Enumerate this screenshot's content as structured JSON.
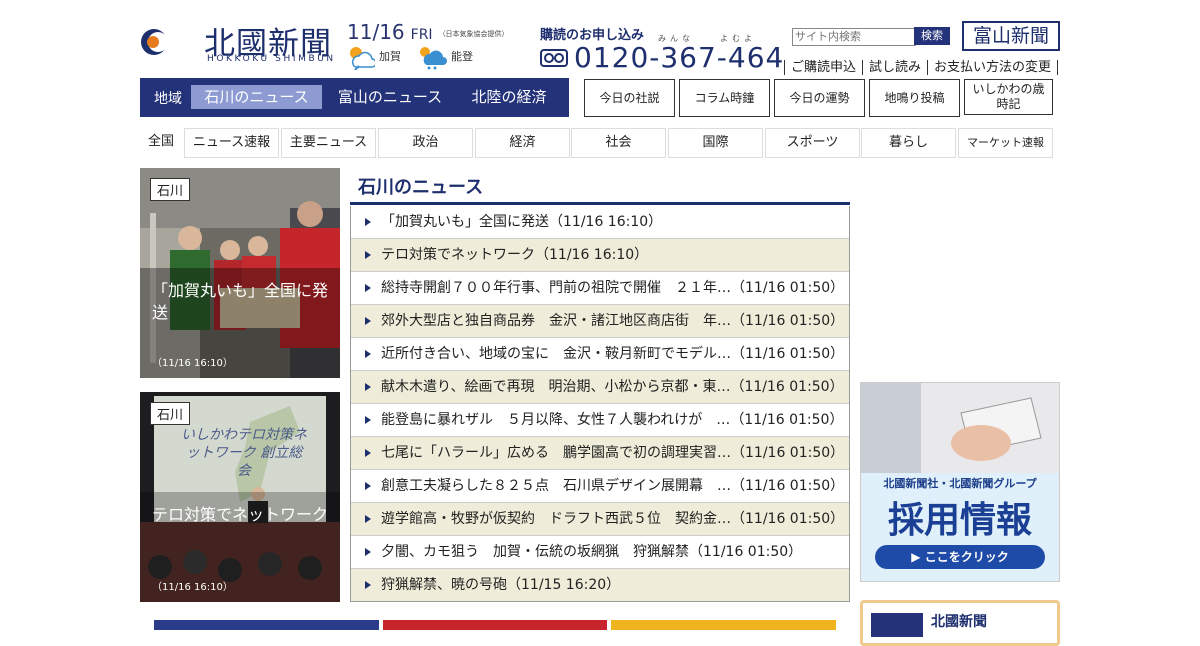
{
  "brand": {
    "name_kanji": "北國新聞",
    "name_roman": "HOKKOKU SHIMBUN"
  },
  "date": {
    "date": "11/16",
    "weekday": "FRI",
    "source_note": "（日本気象協会提供）"
  },
  "weather": [
    {
      "area": "加賀",
      "icon": "sun-cloud-icon"
    },
    {
      "area": "能登",
      "icon": "sun-rain-icon"
    }
  ],
  "subscription": {
    "title": "購読のお申し込み",
    "reading_1": "みんな",
    "reading_2": "よむよ",
    "phone": "0120-367-464"
  },
  "search": {
    "placeholder": "サイト内検索",
    "button": "検索"
  },
  "toyama_paper": "富山新聞",
  "header_links": [
    "ご購読申込",
    "試し読み",
    "お支払い方法の変更"
  ],
  "region_nav": {
    "label": "地域",
    "tabs": [
      "石川のニュース",
      "富山のニュース",
      "北陸の経済"
    ],
    "active": 0
  },
  "feature_buttons": [
    "今日の社説",
    "コラム時鐘",
    "今日の運勢",
    "地鳴り投稿",
    "いしかわの歳時記"
  ],
  "categories": [
    "全国",
    "ニュース速報",
    "主要ニュース",
    "政治",
    "経済",
    "社会",
    "国際",
    "スポーツ",
    "暮らし",
    "マーケット速報"
  ],
  "features": [
    {
      "tag": "石川",
      "caption": "「加賀丸いも」全国に発送",
      "time": "（11/16 16:10）"
    },
    {
      "tag": "石川",
      "caption": "テロ対策でネットワーク",
      "time": "（11/16 16:10）",
      "screen_text": "いしかわテロ対策ネットワーク 創立総会"
    }
  ],
  "news": {
    "title": "石川のニュース",
    "items": [
      {
        "text": "「加賀丸いも」全国に発送",
        "time": "（11/16 16:10）"
      },
      {
        "text": "テロ対策でネットワーク",
        "time": "（11/16 16:10）"
      },
      {
        "text": "総持寺開創７００年行事、門前の祖院で開催　２１年…",
        "time": "（11/16 01:50）"
      },
      {
        "text": "郊外大型店と独自商品券　金沢・諸江地区商店街　年…",
        "time": "（11/16 01:50）"
      },
      {
        "text": "近所付き合い、地域の宝に　金沢・鞍月新町でモデル…",
        "time": "（11/16 01:50）"
      },
      {
        "text": "献木木遣り、絵画で再現　明治期、小松から京都・東…",
        "time": "（11/16 01:50）"
      },
      {
        "text": "能登島に暴れザル　５月以降、女性７人襲われけが　…",
        "time": "（11/16 01:50）"
      },
      {
        "text": "七尾に「ハラール」広める　鵬学園高で初の調理実習…",
        "time": "（11/16 01:50）"
      },
      {
        "text": "創意工夫凝らした８２５点　石川県デザイン展開幕　…",
        "time": "（11/16 01:50）"
      },
      {
        "text": "遊学館高・牧野が仮契約　ドラフト西武５位　契約金…",
        "time": "（11/16 01:50）"
      },
      {
        "text": "夕闇、カモ狙う　加賀・伝統の坂網猟　狩猟解禁",
        "time": "（11/16 01:50）"
      },
      {
        "text": "狩猟解禁、暁の号砲",
        "time": "（11/15 16:20）"
      }
    ]
  },
  "recruit_banner": {
    "company": "北國新聞社・北國新聞グループ",
    "headline": "採用情報",
    "button": "▶ ここをクリック"
  },
  "mini_banner": {
    "title": "北國新聞"
  },
  "colors": {
    "navy": "#24327a",
    "accent_blue": "#1e2f6e",
    "active_tab": "#8d9bd2",
    "row_alt": "#efedd9"
  }
}
